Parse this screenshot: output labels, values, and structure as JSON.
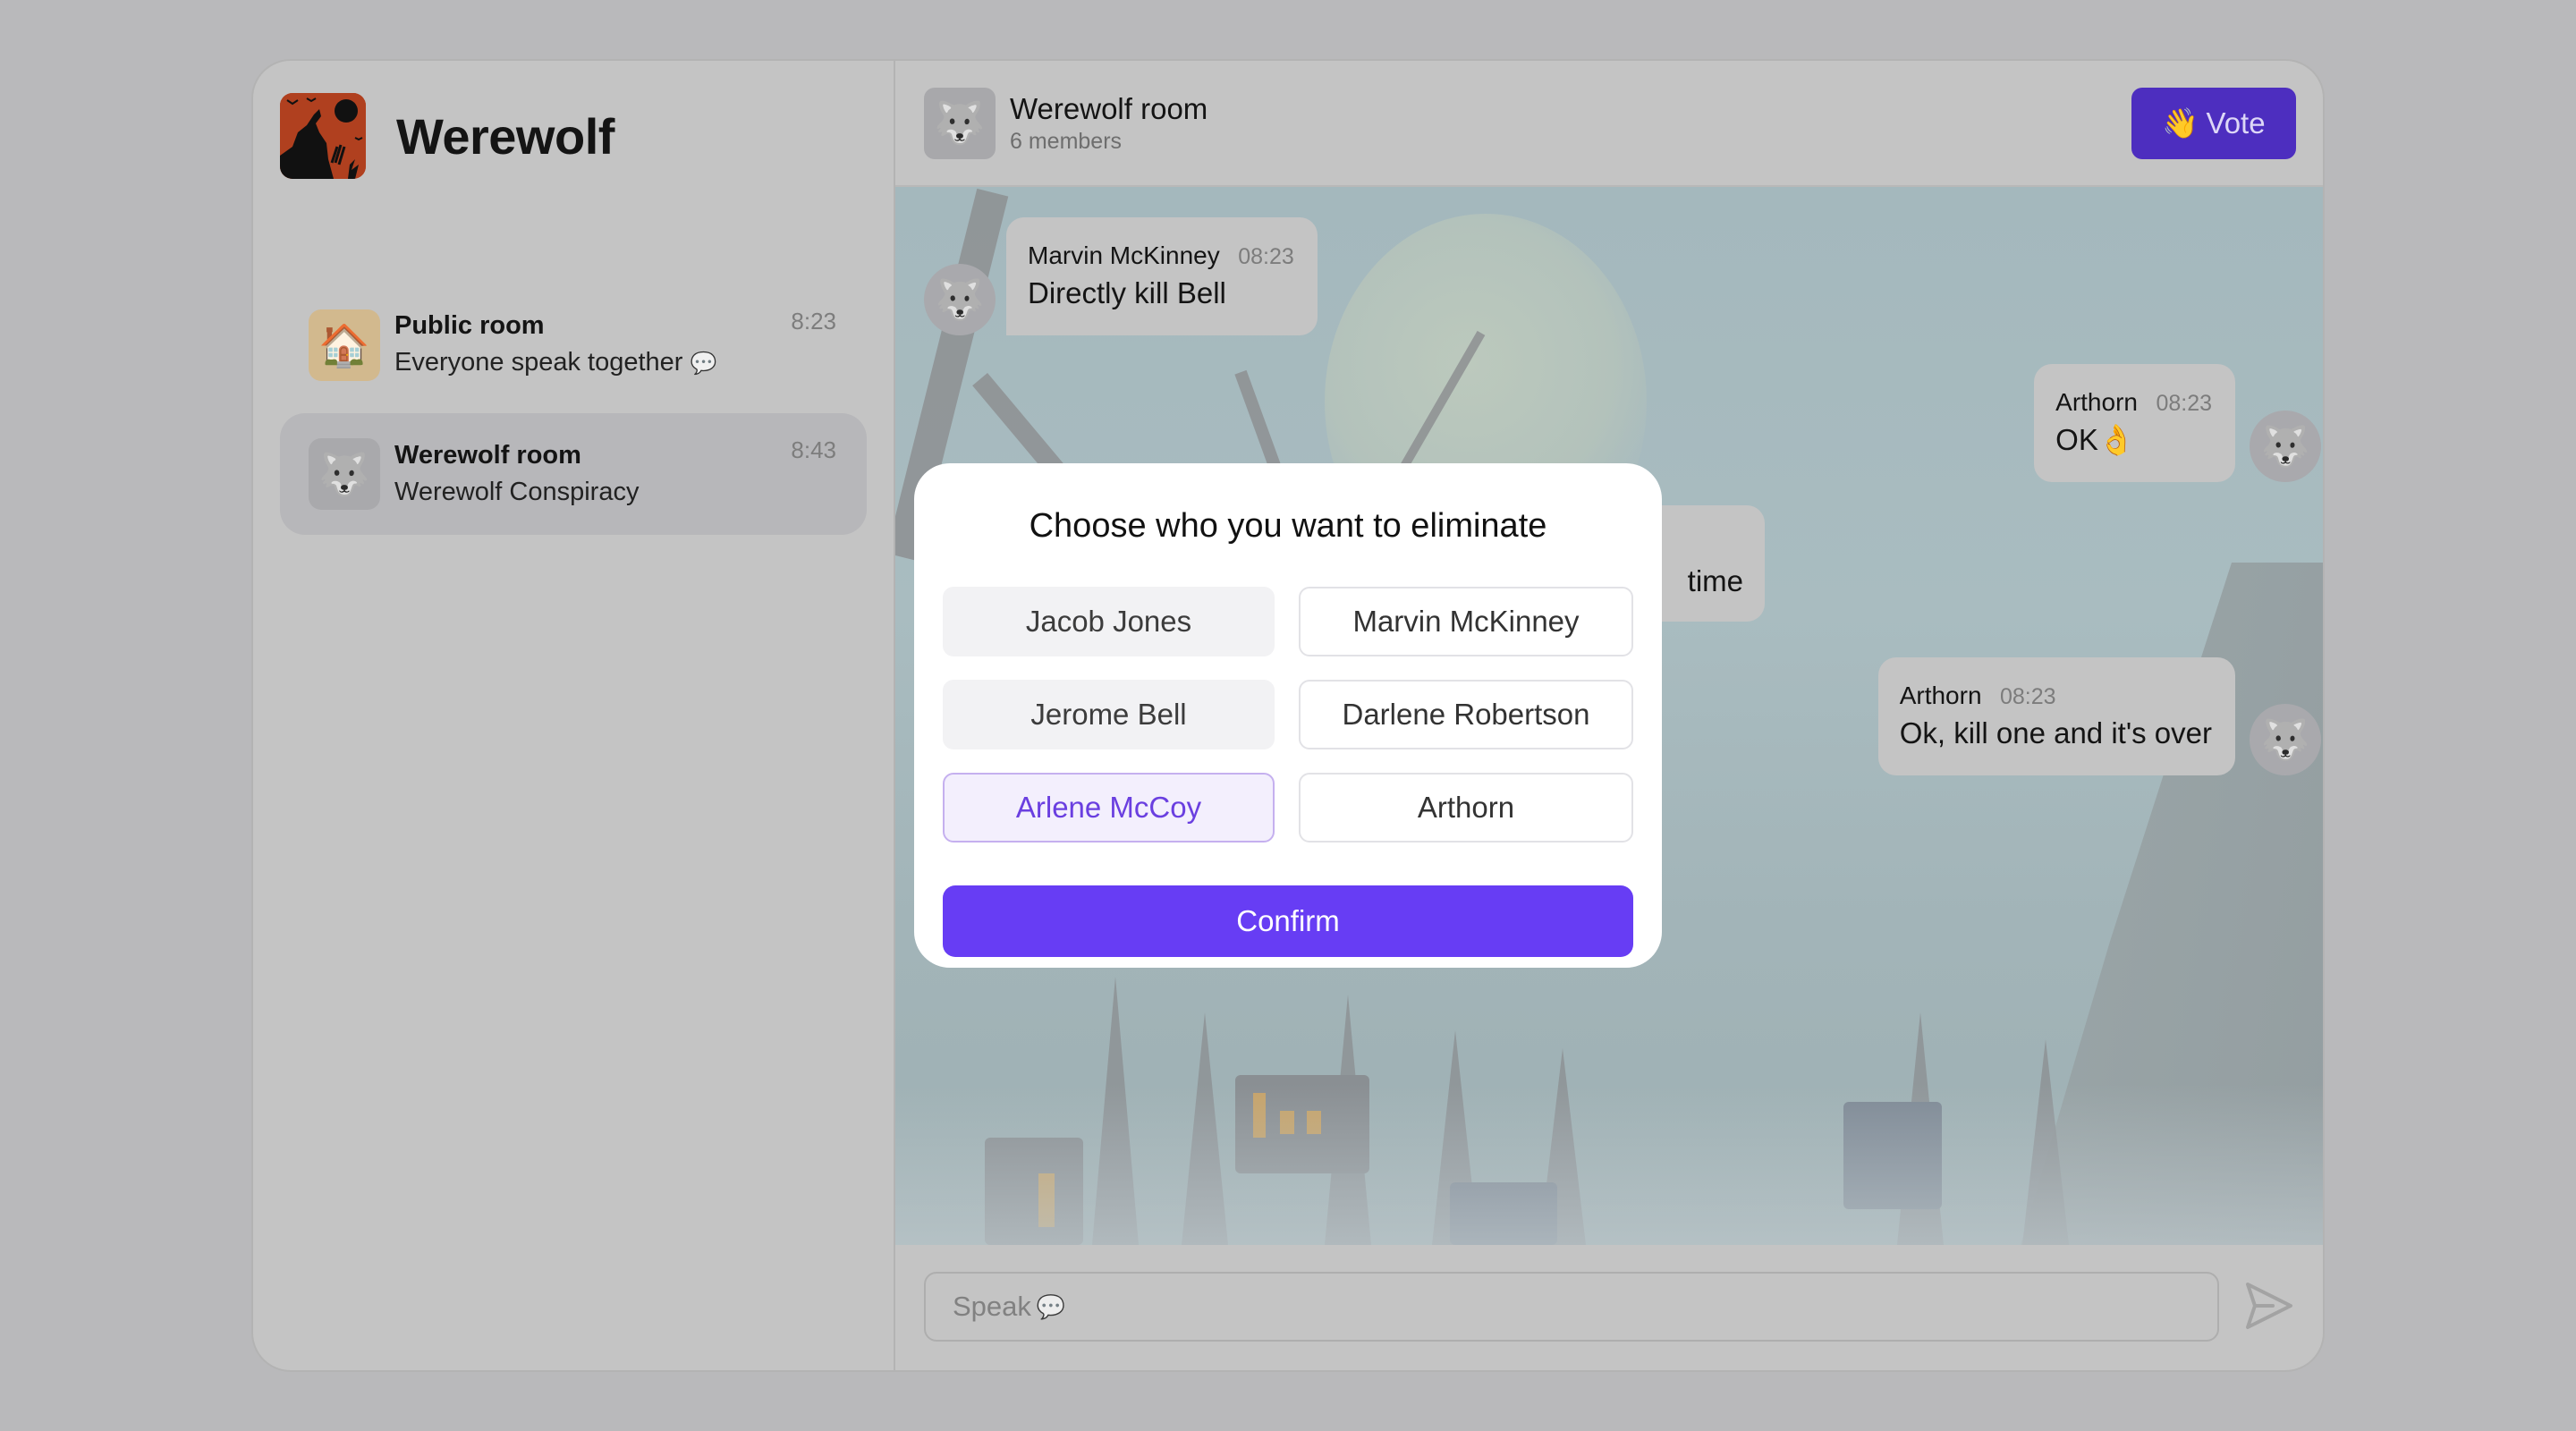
{
  "app": {
    "title": "Werewolf"
  },
  "sidebar": {
    "rooms": [
      {
        "name": "Public room",
        "subtitle": "Everyone speak together",
        "subtitle_emoji": "💬",
        "time": "8:23",
        "icon": "house-emoji",
        "glyph": "🏠",
        "active": false
      },
      {
        "name": "Werewolf room",
        "subtitle": "Werewolf Conspiracy",
        "time": "8:43",
        "icon": "wolf-emoji",
        "glyph": "🐺",
        "active": true
      }
    ]
  },
  "chat": {
    "header": {
      "title": "Werewolf room",
      "members": "6 members",
      "avatar_glyph": "🐺",
      "vote_label": "Vote",
      "vote_emoji": "👋"
    },
    "messages": [
      {
        "sender": "Marvin McKinney",
        "time": "08:23",
        "text": "Directly kill Bell",
        "side": "left",
        "avatar_glyph": "🐺"
      },
      {
        "sender": "Arthorn",
        "time": "08:23",
        "text": "OK👌",
        "side": "right",
        "avatar_glyph": "🐺"
      },
      {
        "sender": "",
        "time": "",
        "text": "time",
        "side": "left",
        "partially_hidden": true
      },
      {
        "sender": "Arthorn",
        "time": "08:23",
        "text": "Ok, kill one and it's over",
        "side": "right",
        "avatar_glyph": "🐺"
      }
    ],
    "composer": {
      "placeholder": "Speak",
      "placeholder_emoji": "💬"
    }
  },
  "modal": {
    "title": "Choose who you want to eliminate",
    "options": [
      {
        "label": "Jacob Jones",
        "state": "disabled"
      },
      {
        "label": "Marvin McKinney",
        "state": "default"
      },
      {
        "label": "Jerome Bell",
        "state": "disabled"
      },
      {
        "label": "Darlene Robertson",
        "state": "default"
      },
      {
        "label": "Arlene McCoy",
        "state": "selected"
      },
      {
        "label": "Arthorn",
        "state": "default"
      }
    ],
    "confirm_label": "Confirm"
  },
  "colors": {
    "accent": "#673df4",
    "vote_button": "#4d2ebf",
    "selected_bg": "#f3effd",
    "selected_text": "#6a3fe0"
  }
}
